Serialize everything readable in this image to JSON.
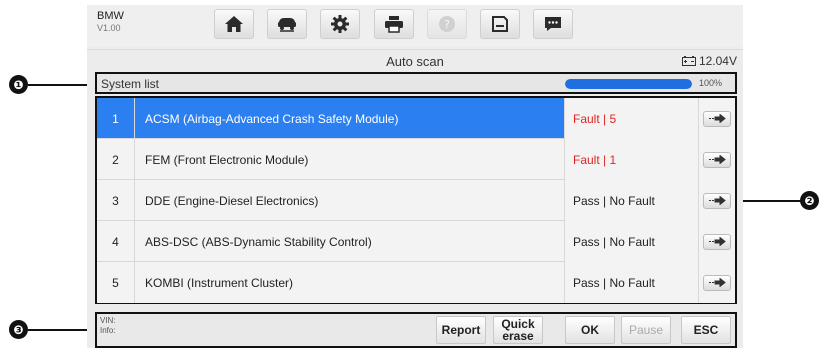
{
  "callouts": [
    "❶",
    "❷",
    "❸"
  ],
  "header": {
    "brand": "BMW",
    "version": "V1.00",
    "tools": [
      {
        "name": "home-icon"
      },
      {
        "name": "vehicle-swap-icon"
      },
      {
        "name": "settings-gear-icon"
      },
      {
        "name": "printer-icon"
      },
      {
        "name": "help-icon"
      },
      {
        "name": "save-icon"
      },
      {
        "name": "message-icon"
      }
    ]
  },
  "title": "Auto scan",
  "voltage": "12.04V",
  "system_list": {
    "label": "System list",
    "progress_percent": 100,
    "progress_label": "100%"
  },
  "rows": [
    {
      "num": "1",
      "name": "ACSM (Airbag-Advanced Crash Safety Module)",
      "status": "Fault | 5",
      "fault": true
    },
    {
      "num": "2",
      "name": "FEM (Front Electronic Module)",
      "status": "Fault | 1",
      "fault": true
    },
    {
      "num": "3",
      "name": "DDE (Engine-Diesel Electronics)",
      "status": "Pass | No Fault",
      "fault": false
    },
    {
      "num": "4",
      "name": "ABS-DSC (ABS-Dynamic Stability Control)",
      "status": "Pass | No Fault",
      "fault": false
    },
    {
      "num": "5",
      "name": "KOMBI (Instrument Cluster)",
      "status": "Pass | No Fault",
      "fault": false
    }
  ],
  "footer": {
    "vin_label": "VIN:",
    "info_label": "Info:",
    "buttons": {
      "report": "Report",
      "quick_erase_1": "Quick",
      "quick_erase_2": "erase",
      "ok": "OK",
      "pause": "Pause",
      "esc": "ESC"
    }
  },
  "colors": {
    "selected_row": "#2c7ff0",
    "fault_text": "#e0261f",
    "progress_fill": "#1f6fe0"
  }
}
